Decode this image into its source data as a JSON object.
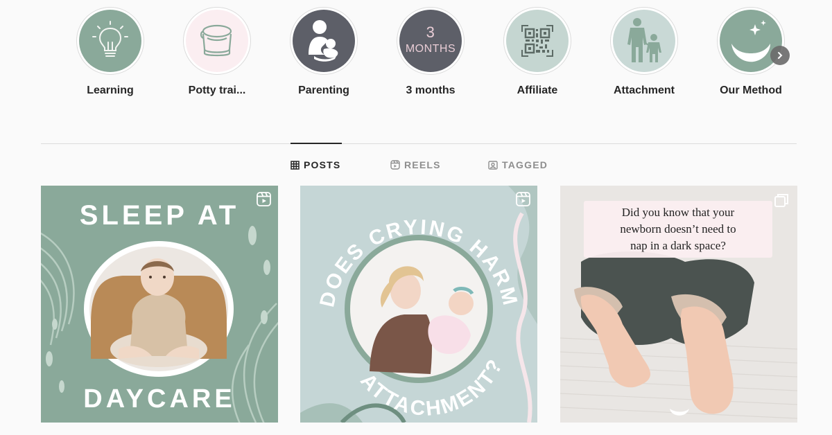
{
  "highlights": [
    {
      "label": "Learning",
      "icon": "lightbulb-icon",
      "bg": "#8aa99a"
    },
    {
      "label": "Potty trai...",
      "icon": "potty-icon",
      "bg": "#fbeef1"
    },
    {
      "label": "Parenting",
      "icon": "parent-child-icon",
      "bg": "#5d5f68"
    },
    {
      "label": "3 months",
      "icon": "three-months-text",
      "bg": "#5d5f68",
      "cover_num": "3",
      "cover_word": "MONTHS"
    },
    {
      "label": "Affiliate",
      "icon": "qr-code-icon",
      "bg": "#c5d6d1"
    },
    {
      "label": "Attachment",
      "icon": "adult-and-child-icon",
      "bg": "#c9d9d6"
    },
    {
      "label": "Our Method",
      "icon": "moon-stars-icon",
      "bg": "#8aa99a"
    }
  ],
  "tabs": [
    {
      "label": "POSTS",
      "icon": "grid-icon",
      "active": true
    },
    {
      "label": "REELS",
      "icon": "reels-icon",
      "active": false
    },
    {
      "label": "TAGGED",
      "icon": "tagged-icon",
      "active": false
    }
  ],
  "posts": [
    {
      "type": "reel",
      "title_top": "SLEEP AT",
      "title_bottom": "DAYCARE",
      "bg": "#8aa99a",
      "badge_icon": "reel-badge-icon"
    },
    {
      "type": "reel",
      "title_top": "DOES CRYING HARM",
      "title_bottom": "ATTACHMENT?",
      "bg": "#c5d6d6",
      "badge_icon": "reel-badge-icon"
    },
    {
      "type": "carousel",
      "caption": [
        "Did you know that your",
        "newborn doesn’t need to",
        "nap in a dark space?"
      ],
      "badge_icon": "carousel-badge-icon"
    }
  ],
  "colors": {
    "sage": "#8aa99a",
    "charcoal": "#5d5f68",
    "blush": "#fbeef1",
    "pale_teal": "#c5d6d6",
    "text": "#262626",
    "muted": "#8e8e8e"
  }
}
